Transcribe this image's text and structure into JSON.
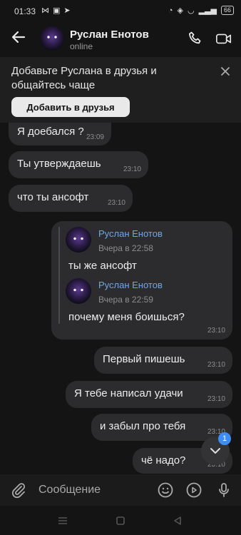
{
  "status_bar": {
    "time": "01:33",
    "battery": "66"
  },
  "header": {
    "name": "Руслан Енотов",
    "status": "online"
  },
  "banner": {
    "text": "Добавьте Руслана в друзья и общайтесь чаще",
    "button": "Добавить в друзья"
  },
  "messages": [
    {
      "text": "Я доебался ?",
      "time": "23:09"
    },
    {
      "text": "Ты утверждаешь",
      "time": "23:10"
    },
    {
      "text": "что ты ансофт",
      "time": "23:10"
    }
  ],
  "forwarded": {
    "time": "23:10",
    "items": [
      {
        "name": "Руслан Енотов",
        "date": "Вчера в 22:58",
        "text": "ты же ансофт"
      },
      {
        "name": "Руслан Енотов",
        "date": "Вчера в 22:59",
        "text": "почему меня боишься?"
      }
    ]
  },
  "outgoing": [
    {
      "text": "Первый пишешь",
      "time": "23:10"
    },
    {
      "text": "Я тебе написал удачи",
      "time": "23:10"
    },
    {
      "text": "и забыл про тебя",
      "time": "23:10"
    },
    {
      "text": "чё надо?",
      "time": "23:10"
    }
  ],
  "composer": {
    "placeholder": "Сообщение"
  },
  "unread_badge": "1",
  "colors": {
    "bubble": "#2c2c2e",
    "accent": "#3d8df5",
    "link": "#6ea6e8"
  },
  "icons": [
    "back-arrow-icon",
    "phone-icon",
    "video-icon",
    "close-icon",
    "attach-icon",
    "emoji-icon",
    "play-icon",
    "mic-icon",
    "chevron-down-icon"
  ]
}
